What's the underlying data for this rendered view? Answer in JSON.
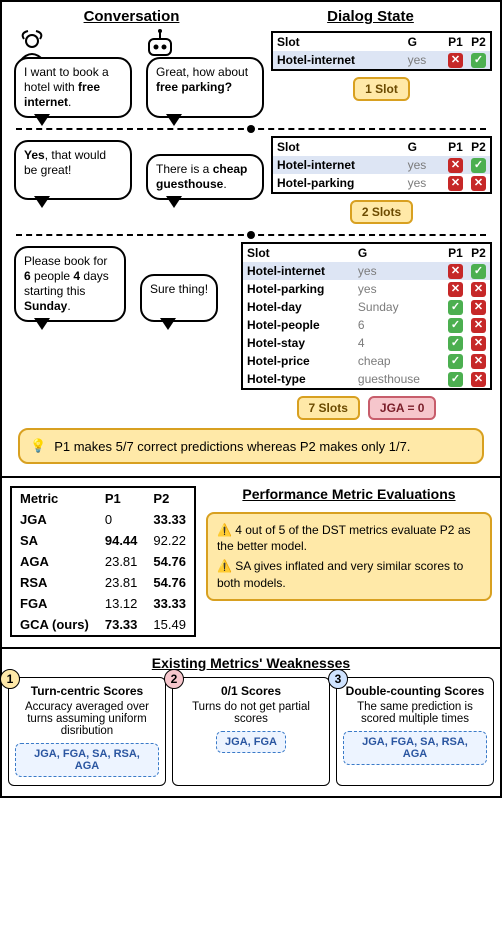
{
  "headers": {
    "conversation": "Conversation",
    "dialogState": "Dialog State"
  },
  "turns": [
    {
      "user_html": "I want to book a hotel with <b>free internet</b>.",
      "sys_html": "Great, how about <b>free parking?</b>",
      "table": {
        "headers": [
          "Slot",
          "G",
          "P1",
          "P2"
        ],
        "rows": [
          {
            "slot": "Hotel-internet",
            "g": "yes",
            "p1": "no",
            "p2": "ok",
            "hl": true
          }
        ]
      },
      "badge": "1 Slot"
    },
    {
      "user_html": "<b>Yes</b>, that would be great!",
      "sys_html": "There is a <b>cheap guesthouse</b>.",
      "table": {
        "headers": [
          "Slot",
          "G",
          "P1",
          "P2"
        ],
        "rows": [
          {
            "slot": "Hotel-internet",
            "g": "yes",
            "p1": "no",
            "p2": "ok",
            "hl": true
          },
          {
            "slot": "Hotel-parking",
            "g": "yes",
            "p1": "no",
            "p2": "no"
          }
        ]
      },
      "badge": "2 Slots"
    },
    {
      "user_html": "Please book for <b>6</b> people <b>4</b> days starting this <b>Sunday</b>.",
      "sys_html": "Sure thing!",
      "table": {
        "headers": [
          "Slot",
          "G",
          "P1",
          "P2"
        ],
        "rows": [
          {
            "slot": "Hotel-internet",
            "g": "yes",
            "p1": "no",
            "p2": "ok",
            "hl": true
          },
          {
            "slot": "Hotel-parking",
            "g": "yes",
            "p1": "no",
            "p2": "no"
          },
          {
            "slot": "Hotel-day",
            "g": "Sunday",
            "p1": "ok",
            "p2": "no"
          },
          {
            "slot": "Hotel-people",
            "g": "6",
            "p1": "ok",
            "p2": "no"
          },
          {
            "slot": "Hotel-stay",
            "g": "4",
            "p1": "ok",
            "p2": "no"
          },
          {
            "slot": "Hotel-price",
            "g": "cheap",
            "p1": "ok",
            "p2": "no"
          },
          {
            "slot": "Hotel-type",
            "g": "guesthouse",
            "p1": "ok",
            "p2": "no"
          }
        ]
      },
      "badge": "7 Slots",
      "jga_badge": "JGA = 0"
    }
  ],
  "note": "P1 makes 5/7 correct predictions whereas P2 makes only 1/7.",
  "metrics_title": "Performance Metric Evaluations",
  "metrics": {
    "headers": [
      "Metric",
      "P1",
      "P2"
    ],
    "rows": [
      {
        "m": "JGA",
        "p1": "0",
        "p2": "33.33",
        "winner": "p2"
      },
      {
        "m": "SA",
        "p1": "94.44",
        "p2": "92.22",
        "winner": "p1"
      },
      {
        "m": "AGA",
        "p1": "23.81",
        "p2": "54.76",
        "winner": "p2"
      },
      {
        "m": "RSA",
        "p1": "23.81",
        "p2": "54.76",
        "winner": "p2"
      },
      {
        "m": "FGA",
        "p1": "13.12",
        "p2": "33.33",
        "winner": "p2"
      },
      {
        "m": "GCA (ours)",
        "p1": "73.33",
        "p2": "15.49",
        "winner": "p1"
      }
    ]
  },
  "warn1": "4 out of 5 of the DST metrics evaluate P2 as the better model.",
  "warn2": "SA gives inflated and very similar scores to both models.",
  "weak_title": "Existing Metrics' Weaknesses",
  "weak": [
    {
      "n": "1",
      "title": "Turn-centric Scores",
      "desc": "Accuracy averaged over turns assuming uniform disribution",
      "chips": "JGA, FGA, SA, RSA, AGA"
    },
    {
      "n": "2",
      "title": "0/1 Scores",
      "desc": "Turns do not get partial scores",
      "chips": "JGA, FGA"
    },
    {
      "n": "3",
      "title": "Double-counting Scores",
      "desc": "The same prediction is scored multiple times",
      "chips": "JGA, FGA, SA, RSA, AGA"
    }
  ],
  "icons": {
    "bulb": "💡",
    "warn": "⚠️"
  }
}
